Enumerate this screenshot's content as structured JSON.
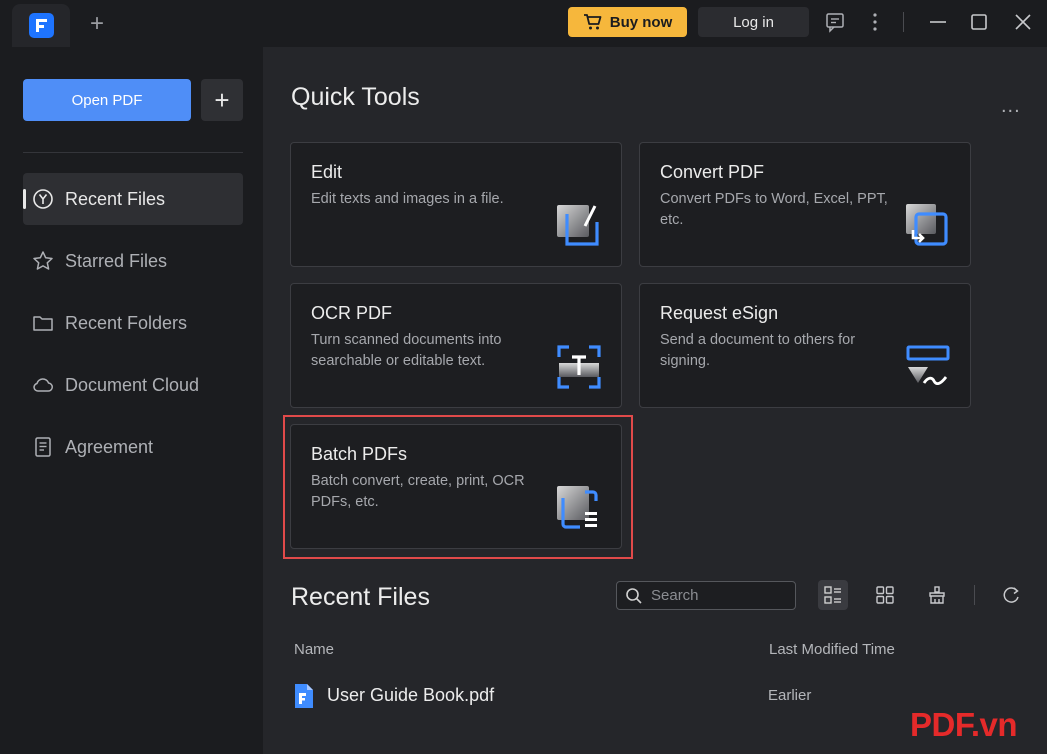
{
  "titlebar": {
    "buy_label": "Buy now",
    "login_label": "Log in",
    "new_tab_label": "+",
    "icons": [
      "app-logo",
      "add-tab-icon",
      "cart-icon",
      "feedback-icon",
      "more-vertical-icon",
      "minimize-icon",
      "maximize-icon",
      "close-icon"
    ]
  },
  "sidebar": {
    "open_pdf_label": "Open PDF",
    "plus_label": "+",
    "items": [
      {
        "label": "Recent Files",
        "icon": "clock-icon",
        "active": true
      },
      {
        "label": "Starred Files",
        "icon": "star-icon",
        "active": false
      },
      {
        "label": "Recent Folders",
        "icon": "folder-icon",
        "active": false
      },
      {
        "label": "Document Cloud",
        "icon": "cloud-icon",
        "active": false
      },
      {
        "label": "Agreement",
        "icon": "document-icon",
        "active": false
      }
    ]
  },
  "quick_tools": {
    "title": "Quick Tools",
    "more_label": "...",
    "cards": [
      {
        "title": "Edit",
        "desc": "Edit texts and images in a file.",
        "icon": "edit-tool-icon"
      },
      {
        "title": "Convert PDF",
        "desc": "Convert PDFs to Word, Excel, PPT, etc.",
        "icon": "convert-tool-icon"
      },
      {
        "title": "OCR PDF",
        "desc": "Turn scanned documents into searchable or editable text.",
        "icon": "ocr-tool-icon"
      },
      {
        "title": "Request eSign",
        "desc": "Send a document to others for signing.",
        "icon": "esign-tool-icon"
      },
      {
        "title": "Batch PDFs",
        "desc": "Batch convert, create, print, OCR PDFs, etc.",
        "icon": "batch-tool-icon",
        "highlighted": true
      }
    ]
  },
  "recent_files": {
    "title": "Recent Files",
    "search_placeholder": "Search",
    "columns": {
      "name": "Name",
      "modified": "Last Modified Time"
    },
    "rows": [
      {
        "name": "User Guide Book.pdf",
        "modified": "Earlier"
      }
    ]
  },
  "watermark": "PDF.vn",
  "colors": {
    "accent": "#4f8ef7",
    "buy": "#f6b73c",
    "highlight": "#e14a4a",
    "watermark": "#e52a2a"
  }
}
